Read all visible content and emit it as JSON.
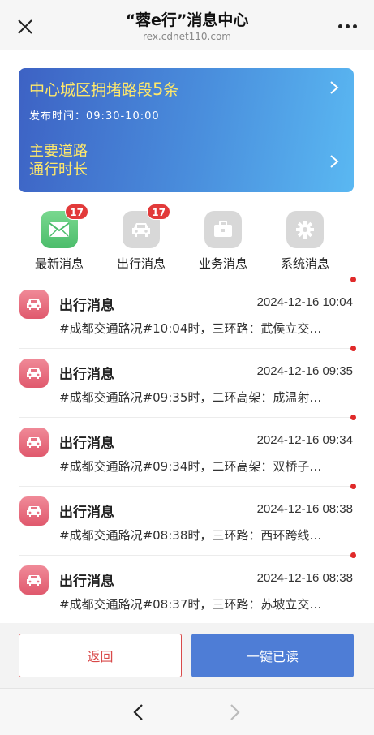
{
  "header": {
    "title": "“蓉e行”消息中心",
    "subtitle": "rex.cdnet110.com"
  },
  "banner": {
    "traffic_prefix": "中心城区拥堵路段",
    "traffic_count": "5",
    "traffic_suffix": "条",
    "time_label": "发布时间：",
    "time_value": "09:30-10:00",
    "road_line1": "主要道路",
    "road_line2": "通行时长"
  },
  "categories": [
    {
      "label": "最新消息",
      "badge": "17",
      "icon": "envelope-icon"
    },
    {
      "label": "出行消息",
      "badge": "17",
      "icon": "car-icon"
    },
    {
      "label": "业务消息",
      "badge": "",
      "icon": "briefcase-icon"
    },
    {
      "label": "系统消息",
      "badge": "",
      "icon": "gear-icon"
    }
  ],
  "messages": [
    {
      "title": "出行消息",
      "time": "2024-12-16 10:04",
      "body": "#成都交通路况#10:04时，三环路：武侯立交…"
    },
    {
      "title": "出行消息",
      "time": "2024-12-16 09:35",
      "body": "#成都交通路况#09:35时，二环高架：成温射…"
    },
    {
      "title": "出行消息",
      "time": "2024-12-16 09:34",
      "body": "#成都交通路况#09:34时，二环高架：双桥子…"
    },
    {
      "title": "出行消息",
      "time": "2024-12-16 08:38",
      "body": "#成都交通路况#08:38时，三环路：西环跨线…"
    },
    {
      "title": "出行消息",
      "time": "2024-12-16 08:38",
      "body": "#成都交通路况#08:37时，三环路：苏坡立交…"
    }
  ],
  "footer": {
    "back_label": "返回",
    "read_all_label": "一键已读"
  },
  "colors": {
    "accent_red": "#d94a4a",
    "button_blue": "#4e7dd6",
    "banner_yellow": "#ffe86a",
    "unread_dot": "#e02a2a"
  }
}
